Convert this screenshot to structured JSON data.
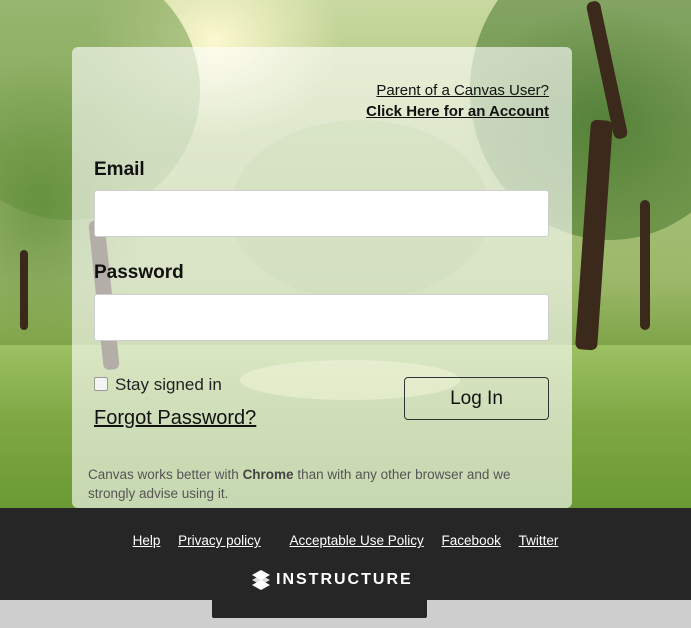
{
  "parent": {
    "line1": "Parent of a Canvas User?",
    "line2": "Click Here for an Account"
  },
  "email": {
    "label": "Email",
    "value": "",
    "placeholder": ""
  },
  "password": {
    "label": "Password",
    "value": "",
    "placeholder": ""
  },
  "stay_signed_in": {
    "label": "Stay signed in",
    "checked": false
  },
  "forgot": "Forgot Password?",
  "login_button": "Log In",
  "notice": {
    "before": "Canvas works better with ",
    "browser": "Chrome",
    "after": " than with any other browser and we strongly advise using it."
  },
  "footer": {
    "links": [
      "Help",
      "Privacy policy",
      "Acceptable Use Policy",
      "Facebook",
      "Twitter"
    ],
    "brand": "INSTRUCTURE"
  }
}
